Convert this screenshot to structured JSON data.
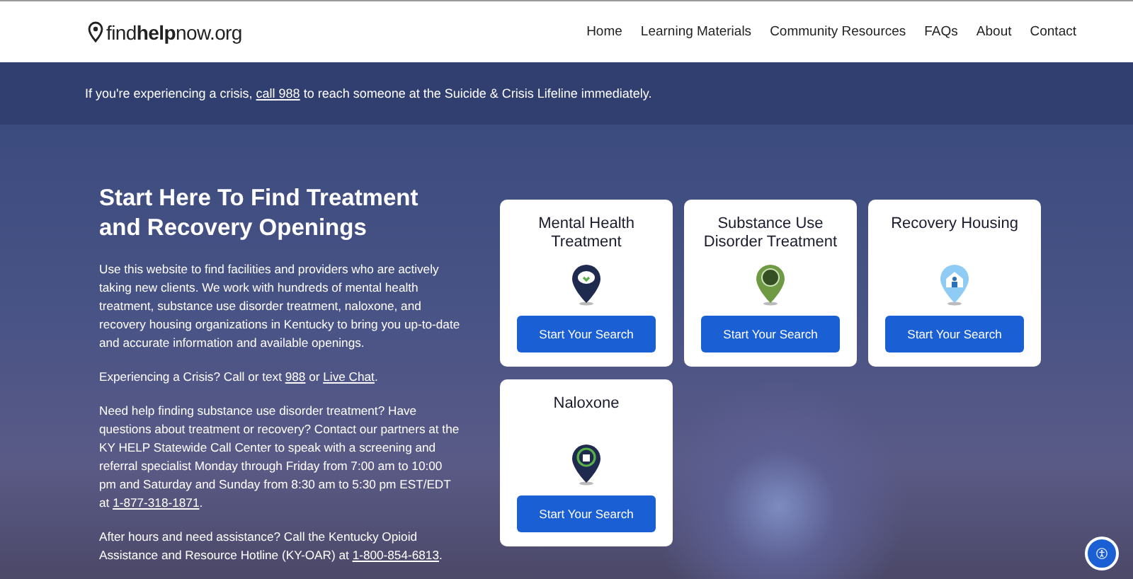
{
  "header": {
    "logo": "find**help**now.org",
    "nav": [
      "Home",
      "Learning Materials",
      "Community Resources",
      "FAQs",
      "About",
      "Contact"
    ]
  },
  "crisis_bar": [
    {
      "kind": "text",
      "text": "If you're experiencing a crisis, "
    },
    {
      "kind": "link",
      "text": "call 988"
    },
    {
      "kind": "text",
      "text": " to reach someone at the Suicide & Crisis Lifeline immediately."
    }
  ],
  "intro": {
    "heading": "Start Here To Find Treatment and Recovery Openings",
    "paragraphs": [
      [
        {
          "kind": "text",
          "text": "Use this website to find facilities and providers who are actively taking new clients. We work with hundreds of mental health treatment, substance use disorder treatment, naloxone, and recovery housing organizations in Kentucky to bring you up-to-date and accurate information and available openings."
        }
      ],
      [
        {
          "kind": "text",
          "text": "Experiencing a Crisis? Call or text "
        },
        {
          "kind": "link",
          "text": "988"
        },
        {
          "kind": "text",
          "text": " or "
        },
        {
          "kind": "link",
          "text": "Live Chat"
        },
        {
          "kind": "text",
          "text": "."
        }
      ],
      [
        {
          "kind": "text",
          "text": "Need help finding substance use disorder treatment? Have questions about treatment or recovery? Contact our partners at the KY HELP Statewide Call Center to speak with a screening and referral specialist Monday through Friday from 7:00 am to 10:00 pm and Saturday and Sunday from 8:30 am to 5:30 pm EST/EDT at "
        },
        {
          "kind": "link",
          "text": "1-877-318-1871"
        },
        {
          "kind": "text",
          "text": "."
        }
      ],
      [
        {
          "kind": "text",
          "text": "After hours and need assistance? Call the Kentucky Opioid Assistance and Resource Hotline (KY-OAR) at "
        },
        {
          "kind": "link",
          "text": "1-800-854-6813"
        },
        {
          "kind": "text",
          "text": "."
        }
      ]
    ]
  },
  "cards": [
    {
      "title": "Mental Health Treatment",
      "kind": "brain",
      "button": "Start Your Search"
    },
    {
      "title": "Substance Use Disorder Treatment",
      "kind": "circle",
      "button": "Start Your Search"
    },
    {
      "title": "Recovery Housing",
      "kind": "house",
      "button": "Start Your Search"
    },
    {
      "title": "Naloxone",
      "kind": "kit",
      "button": "Start Your Search"
    }
  ]
}
